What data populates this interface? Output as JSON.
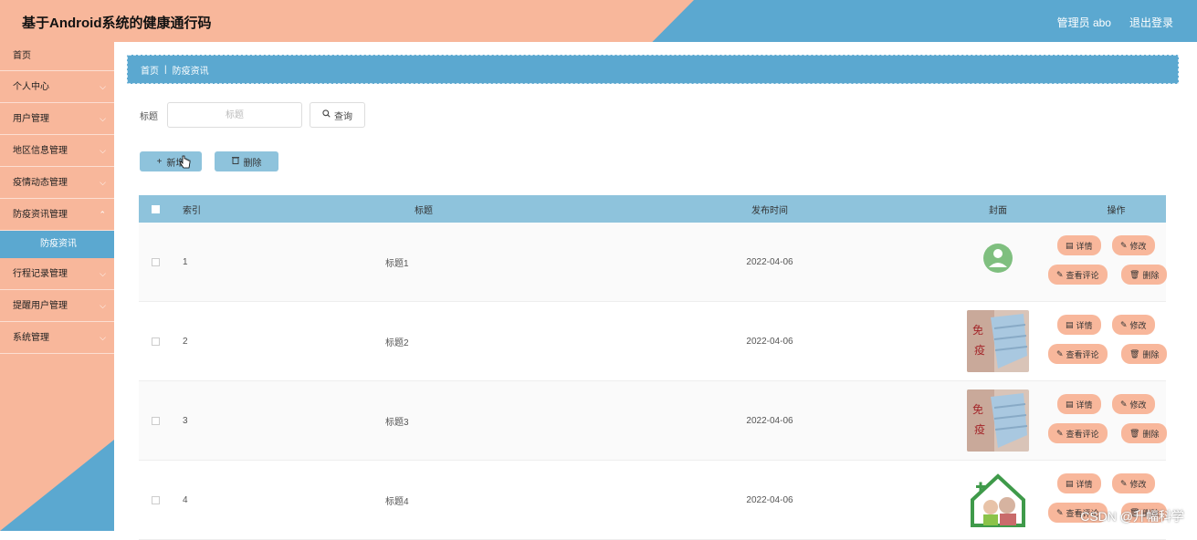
{
  "header": {
    "title": "基于Android系统的健康通行码",
    "user": "管理员 abo",
    "logout": "退出登录"
  },
  "sidebar": {
    "items": [
      {
        "label": "首页",
        "has_chevron": false
      },
      {
        "label": "个人中心",
        "has_chevron": true
      },
      {
        "label": "用户管理",
        "has_chevron": true
      },
      {
        "label": "地区信息管理",
        "has_chevron": true
      },
      {
        "label": "疫情动态管理",
        "has_chevron": true
      },
      {
        "label": "防疫资讯管理",
        "has_chevron": true
      },
      {
        "label": "防疫资讯",
        "sub": true
      },
      {
        "label": "行程记录管理",
        "has_chevron": true
      },
      {
        "label": "提醒用户管理",
        "has_chevron": true
      },
      {
        "label": "系统管理",
        "has_chevron": true
      }
    ]
  },
  "breadcrumb": {
    "home": "首页",
    "current": "防疫资讯"
  },
  "search": {
    "label": "标题",
    "placeholder": "标题",
    "button": "查询"
  },
  "actions": {
    "add": "新增",
    "delete": "删除"
  },
  "table": {
    "headers": {
      "index": "索引",
      "title": "标题",
      "date": "发布时间",
      "cover": "封面",
      "ops": "操作"
    },
    "rows": [
      {
        "index": "1",
        "title": "标题1",
        "date": "2022-04-06",
        "cover": "doctor-icon"
      },
      {
        "index": "2",
        "title": "标题2",
        "date": "2022-04-06",
        "cover": "mask-photo"
      },
      {
        "index": "3",
        "title": "标题3",
        "date": "2022-04-06",
        "cover": "mask-photo"
      },
      {
        "index": "4",
        "title": "标题4",
        "date": "2022-04-06",
        "cover": "elderly-house-illustration"
      }
    ],
    "row_actions": {
      "detail": "详情",
      "edit": "修改",
      "comments": "查看评论",
      "delete": "删除"
    }
  },
  "watermark": "CSDN @升幅科学",
  "colors": {
    "peach": "#f8b79b",
    "blue": "#5ba8d0",
    "light_blue": "#8ec3dc"
  }
}
